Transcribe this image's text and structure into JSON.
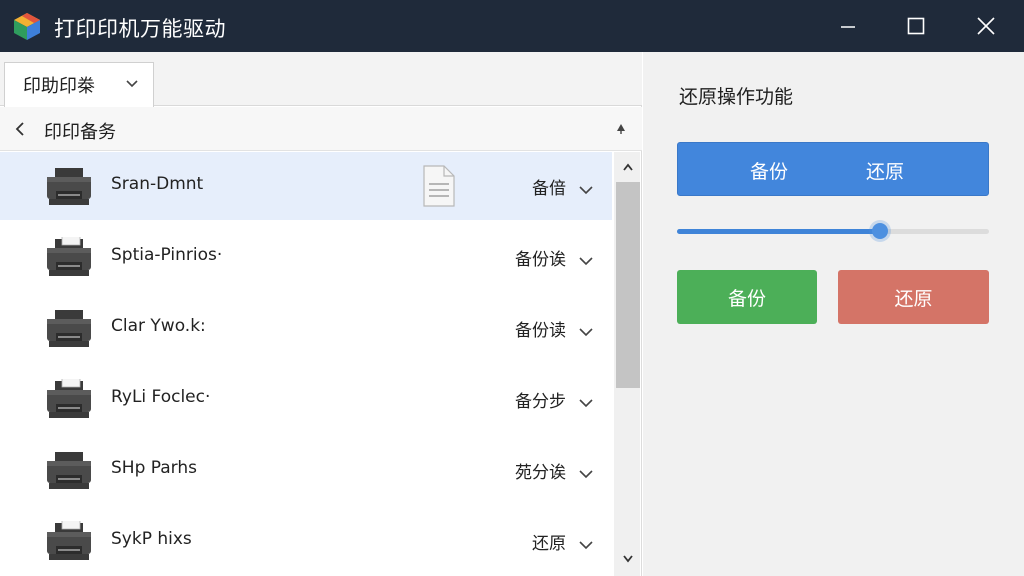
{
  "window": {
    "title": "打印印机万能驱动",
    "minimize_icon": "minimize-icon",
    "maximize_icon": "maximize-icon",
    "close_icon": "close-icon"
  },
  "tab": {
    "label": "印助印桊"
  },
  "subheader": {
    "title": "印印备务"
  },
  "printers": [
    {
      "name": "Sran-Dmnt",
      "status": "备偣",
      "selected": true,
      "icon": "document-icon"
    },
    {
      "name": "Sptia-Pinrios·",
      "status": "备份诶",
      "selected": false
    },
    {
      "name": "Clar Ywo.k:",
      "status": "备份读",
      "selected": false
    },
    {
      "name": "RyLi Foclec·",
      "status": "备分步",
      "selected": false
    },
    {
      "name": "SHp Parhs",
      "status": "苑分诶",
      "selected": false
    },
    {
      "name": "SykP hixs",
      "status": "还原",
      "selected": false
    }
  ],
  "panel": {
    "title": "还原操作功能",
    "segment": {
      "left": "备份",
      "right": "还原"
    },
    "slider_value": 0.65,
    "backup_button": "备份",
    "restore_button": "还原"
  },
  "colors": {
    "titlebar": "#1f2a3a",
    "accent": "#4286dc",
    "backup": "#4caf58",
    "restore": "#d47467",
    "selected_row": "#e6eefb"
  }
}
